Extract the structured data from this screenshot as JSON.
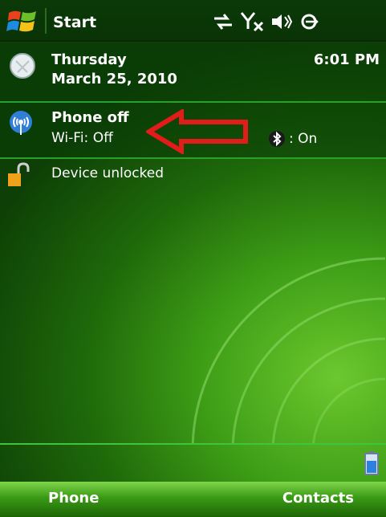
{
  "titlebar": {
    "start_label": "Start",
    "icons": [
      "windows-logo-icon",
      "data-sync-icon",
      "signal-off-icon",
      "volume-off-icon",
      "power-icon"
    ]
  },
  "today": {
    "day": "Thursday",
    "date": "March 25, 2010",
    "time": "6:01 PM",
    "phone_title": "Phone off",
    "wifi_status": "Wi-Fi: Off",
    "bluetooth_status": ": On",
    "lock_text": "Device unlocked"
  },
  "annotation": {
    "arrow_color": "#e21b1b"
  },
  "softkeys": {
    "left": "Phone",
    "right": "Contacts"
  },
  "colors": {
    "accent": "#3fc43f",
    "background": "#2f8a12"
  }
}
